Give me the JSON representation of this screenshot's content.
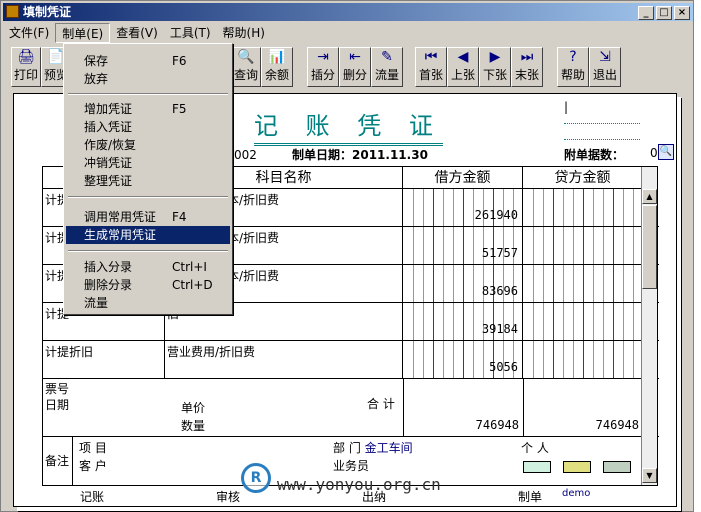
{
  "window": {
    "title": "填制凭证"
  },
  "menubar": [
    "文件(F)",
    "制单(E)",
    "查看(V)",
    "工具(T)",
    "帮助(H)"
  ],
  "toolbar": [
    {
      "label": "打印",
      "icon": "🖨"
    },
    {
      "label": "预览",
      "icon": "📄"
    },
    {
      "label": "查询",
      "icon": "🔍"
    },
    {
      "label": "余额",
      "icon": "📊"
    },
    {
      "label": "插分",
      "icon": "⇥"
    },
    {
      "label": "删分",
      "icon": "⇤"
    },
    {
      "label": "流量",
      "icon": "✎"
    },
    {
      "label": "首张",
      "icon": "⏮"
    },
    {
      "label": "上张",
      "icon": "◀"
    },
    {
      "label": "下张",
      "icon": "▶"
    },
    {
      "label": "末张",
      "icon": "⏭"
    },
    {
      "label": "帮助",
      "icon": "?"
    },
    {
      "label": "退出",
      "icon": "⇲"
    }
  ],
  "menu": {
    "items": [
      {
        "label": "保存",
        "shortcut": "F6"
      },
      {
        "label": "放弃",
        "shortcut": ""
      },
      {
        "label": "增加凭证",
        "shortcut": "F5"
      },
      {
        "label": "插入凭证",
        "shortcut": ""
      },
      {
        "label": "作废/恢复",
        "shortcut": ""
      },
      {
        "label": "冲销凭证",
        "shortcut": ""
      },
      {
        "label": "整理凭证",
        "shortcut": ""
      },
      {
        "label": "调用常用凭证",
        "shortcut": "F4"
      },
      {
        "label": "生成常用凭证",
        "shortcut": ""
      },
      {
        "label": "插入分录",
        "shortcut": "Ctrl+I"
      },
      {
        "label": "删除分录",
        "shortcut": "Ctrl+D"
      },
      {
        "label": "流量",
        "shortcut": ""
      }
    ]
  },
  "voucher": {
    "title": "记 账 凭 证",
    "number_frag": "002",
    "date_label": "制单日期：2011.11.30",
    "attach_label": "附单据数：",
    "attach_count": "0",
    "col_account": "科目名称",
    "col_debit": "借方金额",
    "col_credit": "贷方金额",
    "rows": [
      {
        "summary": "计提",
        "account": "基本生产成本/折旧费",
        "debit": "261940",
        "credit": ""
      },
      {
        "summary": "计提",
        "account": "基本生产成本/折旧费",
        "debit": "51757",
        "credit": ""
      },
      {
        "summary": "计提",
        "account": "基本生产成本/折旧费",
        "debit": "83696",
        "credit": ""
      },
      {
        "summary": "计提",
        "account": "旧",
        "debit": "39184",
        "credit": ""
      },
      {
        "summary": "计提折旧",
        "account": "营业费用/折旧费",
        "debit": "5056",
        "credit": ""
      }
    ],
    "ticket_label": "票号",
    "date_field_label": "日期",
    "price_label": "单价",
    "qty_label": "数量",
    "total_label": "合 计",
    "total_debit": "746948",
    "total_credit": "746948",
    "remark_label": "备注",
    "project_label": "项 目",
    "dept_label": "部 门",
    "dept_value": "金工车间",
    "person_label": "个 人",
    "customer_label": "客 户",
    "salesman_label": "业务员",
    "booker_label": "记账",
    "auditor_label": "审核",
    "cashier_label": "出纳",
    "maker_label": "制单",
    "maker_value": "demo"
  },
  "watermark": {
    "text": "www.yonyou.org.cn",
    "logo": "R"
  },
  "colors": {
    "title_teal": "#008080",
    "selected": "#0a246a",
    "red_line": "#e00000",
    "blue_line": "#3030c0"
  }
}
